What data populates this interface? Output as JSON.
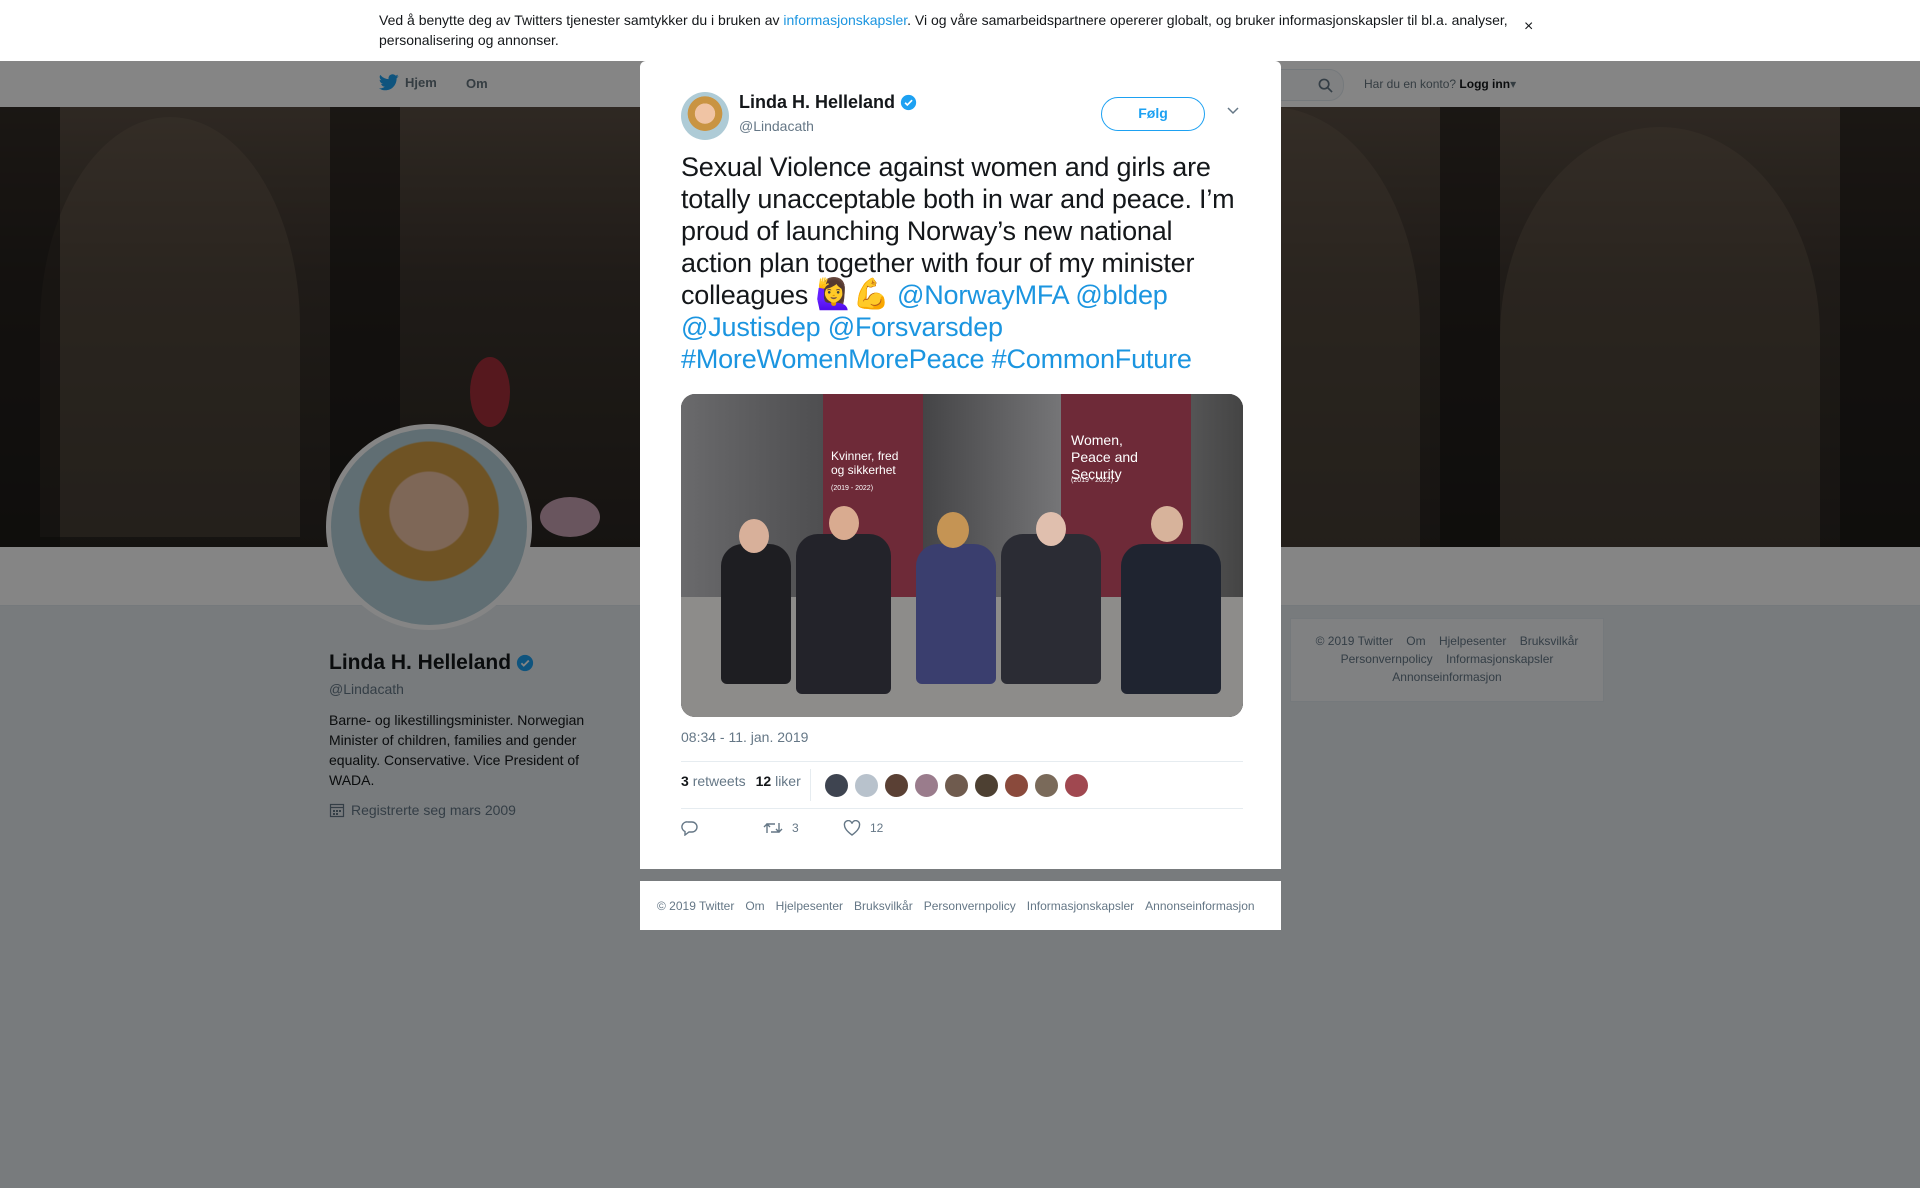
{
  "cookie_banner": {
    "text_before": "Ved å benytte deg av Twitters tjenester samtykker du i bruken av ",
    "link": "informasjonskapsler",
    "text_after": ". Vi og våre samarbeidspartnere opererer globalt, og bruker informasjonskapsler til bl.a. analyser, personalisering og annonser.",
    "close": "×"
  },
  "nav": {
    "home": "Hjem",
    "about": "Om",
    "login_prompt": "Har du en konto?",
    "login": "Logg inn"
  },
  "profile": {
    "name": "Linda H. Helleland",
    "handle": "@Lindacath",
    "bio": "Barne- og likestillingsminister. Norwegian Minister of children, families and gender equality. Conservative. Vice President of WADA.",
    "joined": "Registrerte seg mars 2009"
  },
  "side_footer": {
    "items": [
      "© 2019 Twitter",
      "Om",
      "Hjelpesenter",
      "Bruksvilkår",
      "Personvernpolicy",
      "Informasjonskapsler",
      "Annonseinformasjon"
    ]
  },
  "modal": {
    "close": "×",
    "author_name": "Linda H. Helleland",
    "author_handle": "@Lindacath",
    "follow": "Følg",
    "text_plain": "Sexual Violence against women and girls are totally unacceptable both in war and peace. I’m proud of launching Norway’s new national action plan together with four of my minister colleagues",
    "emojis": "🙋‍♀️💪",
    "mentions": [
      "@NorwayMFA",
      "@bldep",
      "@Justisdep",
      "@Forsvarsdep"
    ],
    "hashtags": [
      "#MoreWomenMorePeace",
      "#CommonFuture"
    ],
    "photo": {
      "banner_left": "Kvinner, fred og sikkerhet",
      "banner_left_years": "(2019 - 2022)",
      "banner_right": "Women, Peace and Security",
      "banner_right_years": "(2019 - 2022)"
    },
    "timestamp": "08:34 - 11. jan. 2019",
    "retweets_count": "3",
    "retweets_label": "retweets",
    "likes_count": "12",
    "likes_label": "liker",
    "action_retweet_count": "3",
    "action_like_count": "12"
  },
  "modal_footer": {
    "items": [
      "© 2019 Twitter",
      "Om",
      "Hjelpesenter",
      "Bruksvilkår",
      "Personvernpolicy",
      "Informasjonskapsler",
      "Annonseinformasjon"
    ]
  },
  "colors": {
    "accent": "#1da1f2",
    "link": "#1b95e0",
    "verified": "#1da1f2",
    "text_secondary": "#657786"
  }
}
